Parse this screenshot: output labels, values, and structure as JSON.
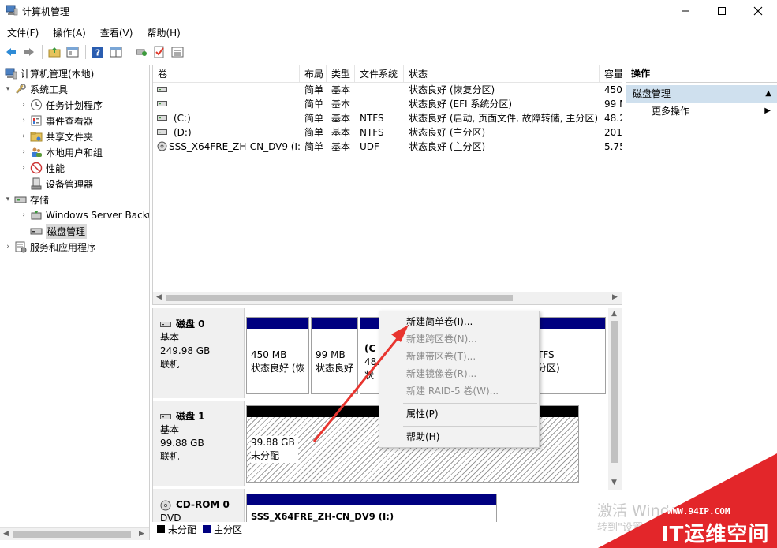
{
  "window": {
    "title": "计算机管理"
  },
  "menu": [
    "文件(F)",
    "操作(A)",
    "查看(V)",
    "帮助(H)"
  ],
  "toolbar_icons": [
    "back-icon",
    "forward-icon",
    "up-folder-icon",
    "show-hide-tree-icon",
    "help-icon",
    "properties-icon",
    "connect-icon",
    "check-icon",
    "list-icon"
  ],
  "tree": {
    "root": "计算机管理(本地)",
    "system_tools": "系统工具",
    "task_scheduler": "任务计划程序",
    "event_viewer": "事件查看器",
    "shared_folders": "共享文件夹",
    "local_users": "本地用户和组",
    "performance": "性能",
    "device_manager": "设备管理器",
    "storage": "存储",
    "backup": "Windows Server Backup",
    "disk_management": "磁盘管理",
    "services": "服务和应用程序"
  },
  "volumes": {
    "columns": [
      "卷",
      "布局",
      "类型",
      "文件系统",
      "状态",
      "容量"
    ],
    "rows": [
      {
        "vol": "",
        "layout": "简单",
        "type": "基本",
        "fs": "",
        "status": "状态良好 (恢复分区)",
        "cap": "450"
      },
      {
        "vol": "",
        "layout": "简单",
        "type": "基本",
        "fs": "",
        "status": "状态良好 (EFI 系统分区)",
        "cap": "99 N"
      },
      {
        "vol": "(C:)",
        "layout": "简单",
        "type": "基本",
        "fs": "NTFS",
        "status": "状态良好 (启动, 页面文件, 故障转储, 主分区)",
        "cap": "48.2"
      },
      {
        "vol": "(D:)",
        "layout": "简单",
        "type": "基本",
        "fs": "NTFS",
        "status": "状态良好 (主分区)",
        "cap": "201"
      },
      {
        "vol": "SSS_X64FRE_ZH-CN_DV9 (I:)",
        "layout": "简单",
        "type": "基本",
        "fs": "UDF",
        "status": "状态良好 (主分区)",
        "cap": "5.75"
      }
    ]
  },
  "disks": {
    "disk0": {
      "name": "磁盘 0",
      "type": "基本",
      "size": "249.98 GB",
      "state": "联机",
      "p1": {
        "size": "450 MB",
        "status": "状态良好 (恢"
      },
      "p2": {
        "size": "99 MB",
        "status": "状态良好"
      },
      "p3": {
        "size": "(C",
        "status": "48.",
        "status2": "状"
      },
      "p4": {
        "size": "TFS",
        "status": "分区)"
      }
    },
    "disk1": {
      "name": "磁盘 1",
      "type": "基本",
      "size": "99.88 GB",
      "state": "联机",
      "p1": {
        "size": "99.88 GB",
        "status": "未分配"
      }
    },
    "cdrom": {
      "name": "CD-ROM 0",
      "type": "DVD",
      "p1": {
        "label": "SSS_X64FRE_ZH-CN_DV9 (I:)"
      }
    }
  },
  "legend": {
    "unallocated": "未分配",
    "primary": "主分区"
  },
  "actions": {
    "header": "操作",
    "section": "磁盘管理",
    "more": "更多操作"
  },
  "context_menu": {
    "new_simple": "新建简单卷(I)...",
    "new_spanned": "新建跨区卷(N)...",
    "new_striped": "新建带区卷(T)...",
    "new_mirrored": "新建镜像卷(R)...",
    "new_raid5": "新建 RAID-5 卷(W)...",
    "properties": "属性(P)",
    "help": "帮助(H)"
  },
  "watermark": {
    "line1": "激活 Windo",
    "line2": "转到\"设置\""
  },
  "badge": {
    "url": "WWW.94IP.COM",
    "name": "IT运维空间"
  },
  "colors": {
    "primary_partition": "#000080",
    "unallocated": "#000000",
    "selection": "#cfe0ee",
    "arrow": "#e8352f",
    "badge": "#e3262a"
  }
}
